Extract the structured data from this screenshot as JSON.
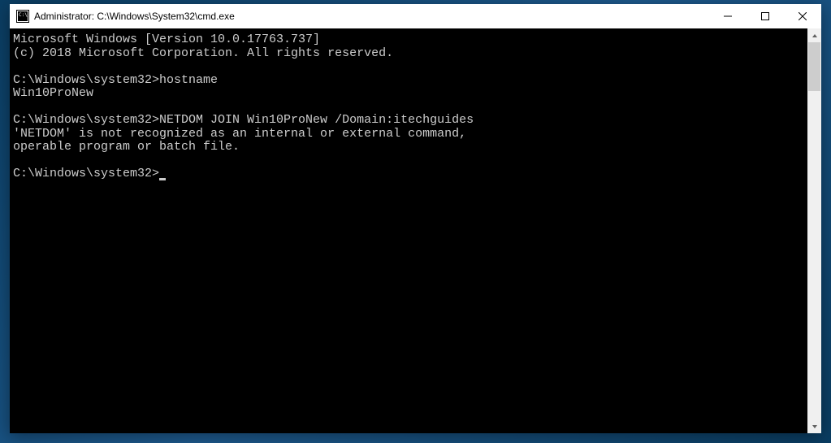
{
  "window": {
    "title": "Administrator: C:\\Windows\\System32\\cmd.exe"
  },
  "console": {
    "banner_line1": "Microsoft Windows [Version 10.0.17763.737]",
    "banner_line2": "(c) 2018 Microsoft Corporation. All rights reserved.",
    "blank1": "",
    "prompt1": "C:\\Windows\\system32>hostname",
    "output1": "Win10ProNew",
    "blank2": "",
    "prompt2": "C:\\Windows\\system32>NETDOM JOIN Win10ProNew /Domain:itechguides",
    "error1": "'NETDOM' is not recognized as an internal or external command,",
    "error2": "operable program or batch file.",
    "blank3": "",
    "prompt3": "C:\\Windows\\system32>"
  }
}
